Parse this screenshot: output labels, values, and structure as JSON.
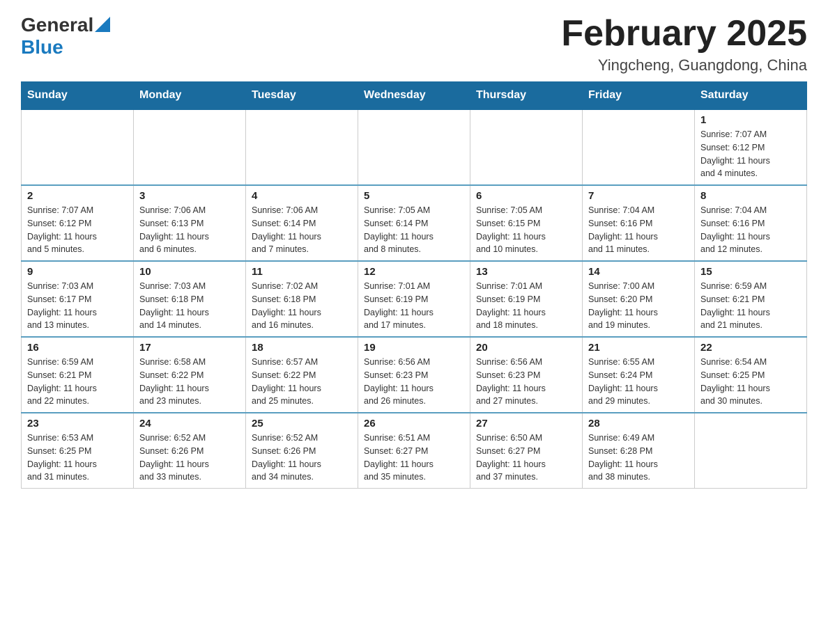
{
  "logo": {
    "general": "General",
    "blue": "Blue",
    "line2": "Blue"
  },
  "header": {
    "month_title": "February 2025",
    "location": "Yingcheng, Guangdong, China"
  },
  "days_of_week": [
    "Sunday",
    "Monday",
    "Tuesday",
    "Wednesday",
    "Thursday",
    "Friday",
    "Saturday"
  ],
  "weeks": [
    [
      {
        "day": "",
        "info": ""
      },
      {
        "day": "",
        "info": ""
      },
      {
        "day": "",
        "info": ""
      },
      {
        "day": "",
        "info": ""
      },
      {
        "day": "",
        "info": ""
      },
      {
        "day": "",
        "info": ""
      },
      {
        "day": "1",
        "info": "Sunrise: 7:07 AM\nSunset: 6:12 PM\nDaylight: 11 hours\nand 4 minutes."
      }
    ],
    [
      {
        "day": "2",
        "info": "Sunrise: 7:07 AM\nSunset: 6:12 PM\nDaylight: 11 hours\nand 5 minutes."
      },
      {
        "day": "3",
        "info": "Sunrise: 7:06 AM\nSunset: 6:13 PM\nDaylight: 11 hours\nand 6 minutes."
      },
      {
        "day": "4",
        "info": "Sunrise: 7:06 AM\nSunset: 6:14 PM\nDaylight: 11 hours\nand 7 minutes."
      },
      {
        "day": "5",
        "info": "Sunrise: 7:05 AM\nSunset: 6:14 PM\nDaylight: 11 hours\nand 8 minutes."
      },
      {
        "day": "6",
        "info": "Sunrise: 7:05 AM\nSunset: 6:15 PM\nDaylight: 11 hours\nand 10 minutes."
      },
      {
        "day": "7",
        "info": "Sunrise: 7:04 AM\nSunset: 6:16 PM\nDaylight: 11 hours\nand 11 minutes."
      },
      {
        "day": "8",
        "info": "Sunrise: 7:04 AM\nSunset: 6:16 PM\nDaylight: 11 hours\nand 12 minutes."
      }
    ],
    [
      {
        "day": "9",
        "info": "Sunrise: 7:03 AM\nSunset: 6:17 PM\nDaylight: 11 hours\nand 13 minutes."
      },
      {
        "day": "10",
        "info": "Sunrise: 7:03 AM\nSunset: 6:18 PM\nDaylight: 11 hours\nand 14 minutes."
      },
      {
        "day": "11",
        "info": "Sunrise: 7:02 AM\nSunset: 6:18 PM\nDaylight: 11 hours\nand 16 minutes."
      },
      {
        "day": "12",
        "info": "Sunrise: 7:01 AM\nSunset: 6:19 PM\nDaylight: 11 hours\nand 17 minutes."
      },
      {
        "day": "13",
        "info": "Sunrise: 7:01 AM\nSunset: 6:19 PM\nDaylight: 11 hours\nand 18 minutes."
      },
      {
        "day": "14",
        "info": "Sunrise: 7:00 AM\nSunset: 6:20 PM\nDaylight: 11 hours\nand 19 minutes."
      },
      {
        "day": "15",
        "info": "Sunrise: 6:59 AM\nSunset: 6:21 PM\nDaylight: 11 hours\nand 21 minutes."
      }
    ],
    [
      {
        "day": "16",
        "info": "Sunrise: 6:59 AM\nSunset: 6:21 PM\nDaylight: 11 hours\nand 22 minutes."
      },
      {
        "day": "17",
        "info": "Sunrise: 6:58 AM\nSunset: 6:22 PM\nDaylight: 11 hours\nand 23 minutes."
      },
      {
        "day": "18",
        "info": "Sunrise: 6:57 AM\nSunset: 6:22 PM\nDaylight: 11 hours\nand 25 minutes."
      },
      {
        "day": "19",
        "info": "Sunrise: 6:56 AM\nSunset: 6:23 PM\nDaylight: 11 hours\nand 26 minutes."
      },
      {
        "day": "20",
        "info": "Sunrise: 6:56 AM\nSunset: 6:23 PM\nDaylight: 11 hours\nand 27 minutes."
      },
      {
        "day": "21",
        "info": "Sunrise: 6:55 AM\nSunset: 6:24 PM\nDaylight: 11 hours\nand 29 minutes."
      },
      {
        "day": "22",
        "info": "Sunrise: 6:54 AM\nSunset: 6:25 PM\nDaylight: 11 hours\nand 30 minutes."
      }
    ],
    [
      {
        "day": "23",
        "info": "Sunrise: 6:53 AM\nSunset: 6:25 PM\nDaylight: 11 hours\nand 31 minutes."
      },
      {
        "day": "24",
        "info": "Sunrise: 6:52 AM\nSunset: 6:26 PM\nDaylight: 11 hours\nand 33 minutes."
      },
      {
        "day": "25",
        "info": "Sunrise: 6:52 AM\nSunset: 6:26 PM\nDaylight: 11 hours\nand 34 minutes."
      },
      {
        "day": "26",
        "info": "Sunrise: 6:51 AM\nSunset: 6:27 PM\nDaylight: 11 hours\nand 35 minutes."
      },
      {
        "day": "27",
        "info": "Sunrise: 6:50 AM\nSunset: 6:27 PM\nDaylight: 11 hours\nand 37 minutes."
      },
      {
        "day": "28",
        "info": "Sunrise: 6:49 AM\nSunset: 6:28 PM\nDaylight: 11 hours\nand 38 minutes."
      },
      {
        "day": "",
        "info": ""
      }
    ]
  ]
}
